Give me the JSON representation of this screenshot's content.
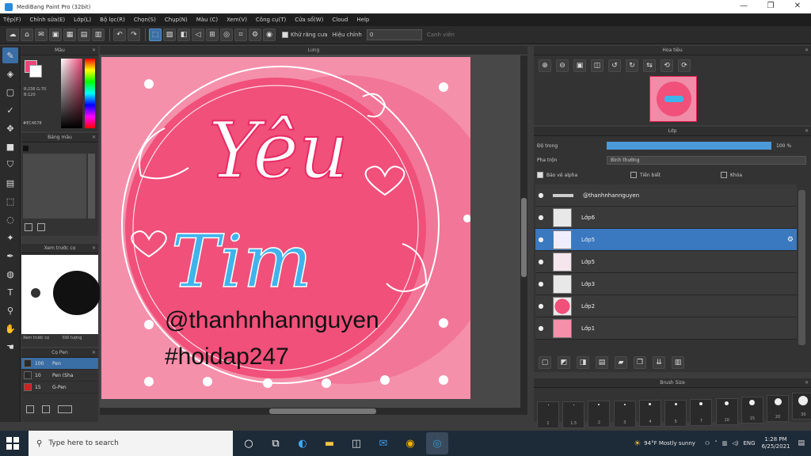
{
  "window": {
    "title": "MediBang Paint Pro (32bit)",
    "controls": [
      "—",
      "❐",
      "✕"
    ]
  },
  "menu": [
    "Tệp(F)",
    "Chỉnh sửa(E)",
    "Lớp(L)",
    "Bộ lọc(R)",
    "Chọn(S)",
    "Chụp(N)",
    "Màu (C)",
    "Xem(V)",
    "Công cụ(T)",
    "Cửa sổ(W)",
    "Cloud",
    "Help"
  ],
  "toolbar": {
    "anti_alias_label": "Khử răng cưa",
    "correction_label": "Hiệu chỉnh",
    "correction_value": "0",
    "snap_label": "Canh viền"
  },
  "color_panel": {
    "title": "Màu",
    "values": "R:236 G:70 B:120",
    "hex": "#EC4678"
  },
  "brush_panel": {
    "title": "Bảng màu"
  },
  "preview_panel": {
    "title": "Xem trước cọ",
    "btn_a": "Xem trước cọ",
    "btn_b": "Đối tượng"
  },
  "pen_panel": {
    "title": "Cọ Pen",
    "rows": [
      {
        "size": "100",
        "name": "Pen"
      },
      {
        "size": "10",
        "name": "Pen (Sha"
      },
      {
        "size": "15",
        "name": "G-Pen"
      }
    ]
  },
  "canvas": {
    "tab": "Lưng",
    "watermark_line1": "@thanhnhannguyen",
    "watermark_line2": "#hoidap247",
    "art_word1": "Yêu",
    "art_word2": "Tim"
  },
  "navigator": {
    "title": "Hoa tiêu"
  },
  "layers": {
    "title": "Lớp",
    "opacity_label": "Độ trong",
    "opacity_value": "100 %",
    "blend_label": "Pha trộn",
    "blend_value": "Bình thường",
    "lock_alpha": "Bảo vệ alpha",
    "clipping": "Tiền biết",
    "lock": "Khóa",
    "items": [
      {
        "name": "@thanhnhannguyen"
      },
      {
        "name": "Lớp6"
      },
      {
        "name": "Lớp5"
      },
      {
        "name": "Lớp5"
      },
      {
        "name": "Lớp3"
      },
      {
        "name": "Lớp2"
      },
      {
        "name": "Lớp1"
      }
    ]
  },
  "brush_size": {
    "title": "Brush Size",
    "sizes": [
      "1",
      "1.5",
      "2",
      "3",
      "4",
      "5",
      "7",
      "10",
      "15",
      "20",
      "30",
      "50"
    ]
  },
  "taskbar": {
    "search_placeholder": "Type here to search",
    "weather": "94°F  Mostly sunny",
    "lang": "ENG",
    "time": "1:28 PM",
    "date": "6/25/2021"
  },
  "colors": {
    "primary": "#ec4678",
    "canvas_pink": "#f08ca8",
    "circle_pink": "#f0507a",
    "blue_text": "#3fb4ec"
  }
}
